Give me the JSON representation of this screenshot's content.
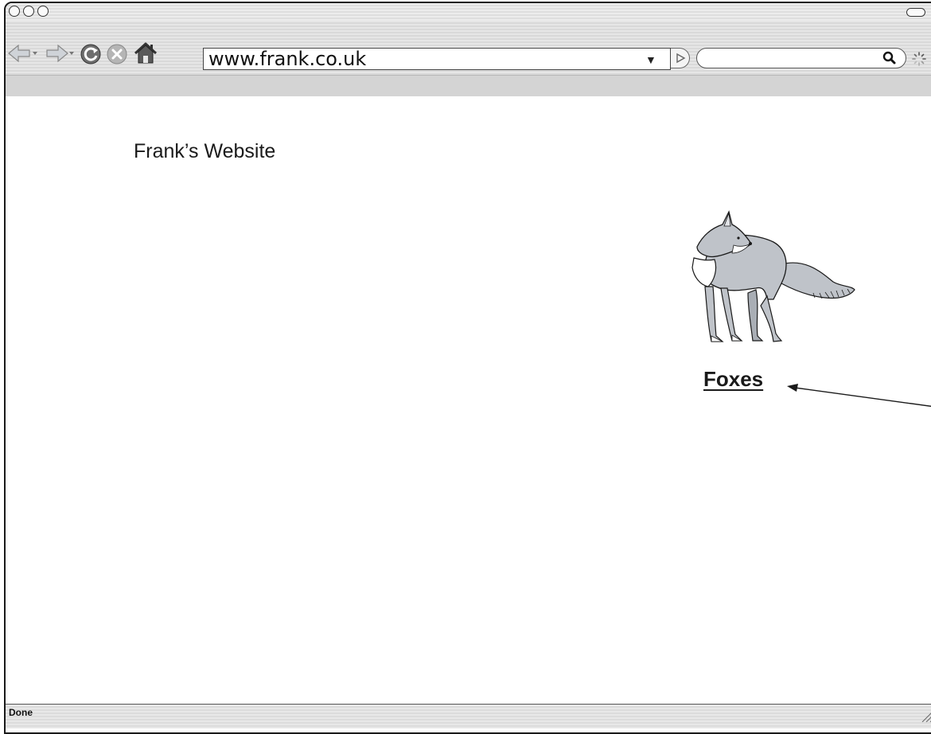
{
  "browser": {
    "toolbar": {
      "back_icon": "back-arrow-icon",
      "forward_icon": "forward-arrow-icon",
      "reload_icon": "reload-icon",
      "stop_icon": "stop-icon",
      "home_icon": "home-icon"
    },
    "address_bar": {
      "url": "www.frank.co.uk"
    },
    "search": {
      "placeholder": ""
    },
    "status": {
      "text": "Done"
    }
  },
  "page": {
    "site_title": "Frank’s Website",
    "link_label": "Foxes",
    "image_icon": "fox-illustration"
  },
  "colors": {
    "text": "#1a1a1a",
    "chrome_light": "#e6e6e6",
    "chrome_dark": "#d9d9d9",
    "fox_grey": "#bfc3c9"
  }
}
